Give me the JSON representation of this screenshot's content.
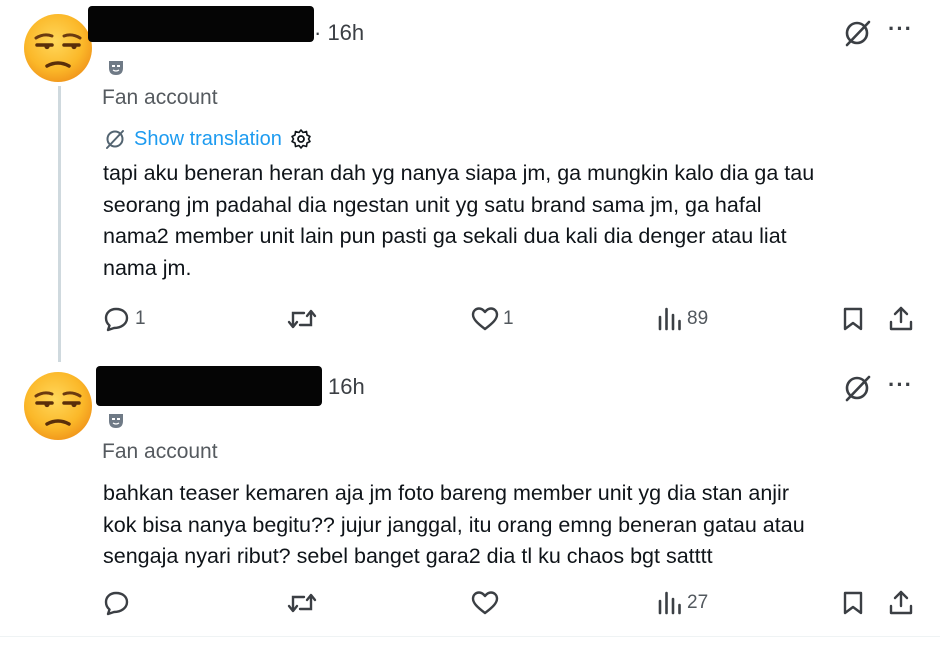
{
  "tweets": [
    {
      "time": "· 16h",
      "label": "Fan account",
      "translation": "Show translation",
      "text_lines": [
        "tapi aku beneran heran dah yg nanya siapa jm, ga mungkin kalo dia ga tau",
        "seorang jm padahal dia ngestan unit yg satu brand sama jm, ga hafal",
        "nama2 member unit lain pun pasti ga sekali dua kali dia denger atau liat",
        "nama jm."
      ],
      "replies": "1",
      "reposts": "",
      "likes": "1",
      "views": "89"
    },
    {
      "time": "16h",
      "label": "Fan account",
      "text_lines": [
        "bahkan teaser kemaren aja jm foto bareng member unit yg dia stan anjir",
        "kok bisa nanya begitu?? jujur janggal, itu orang emng beneran gatau atau",
        "sengaja nyari ribut? sebel banget gara2 dia tl ku chaos bgt satttt"
      ],
      "replies": "",
      "reposts": "",
      "likes": "",
      "views": "27"
    }
  ],
  "more_label": "···",
  "icons": [
    "unamused-face-avatar",
    "mask-badge-icon",
    "grok-icon",
    "more-icon",
    "translate-icon",
    "gear-icon",
    "reply-icon",
    "repost-icon",
    "like-icon",
    "views-icon",
    "bookmark-icon",
    "share-icon"
  ],
  "colors": {
    "link": "#1d9bf0",
    "muted": "#536471",
    "text": "#0f1419",
    "thread_line": "#cfd9de"
  }
}
